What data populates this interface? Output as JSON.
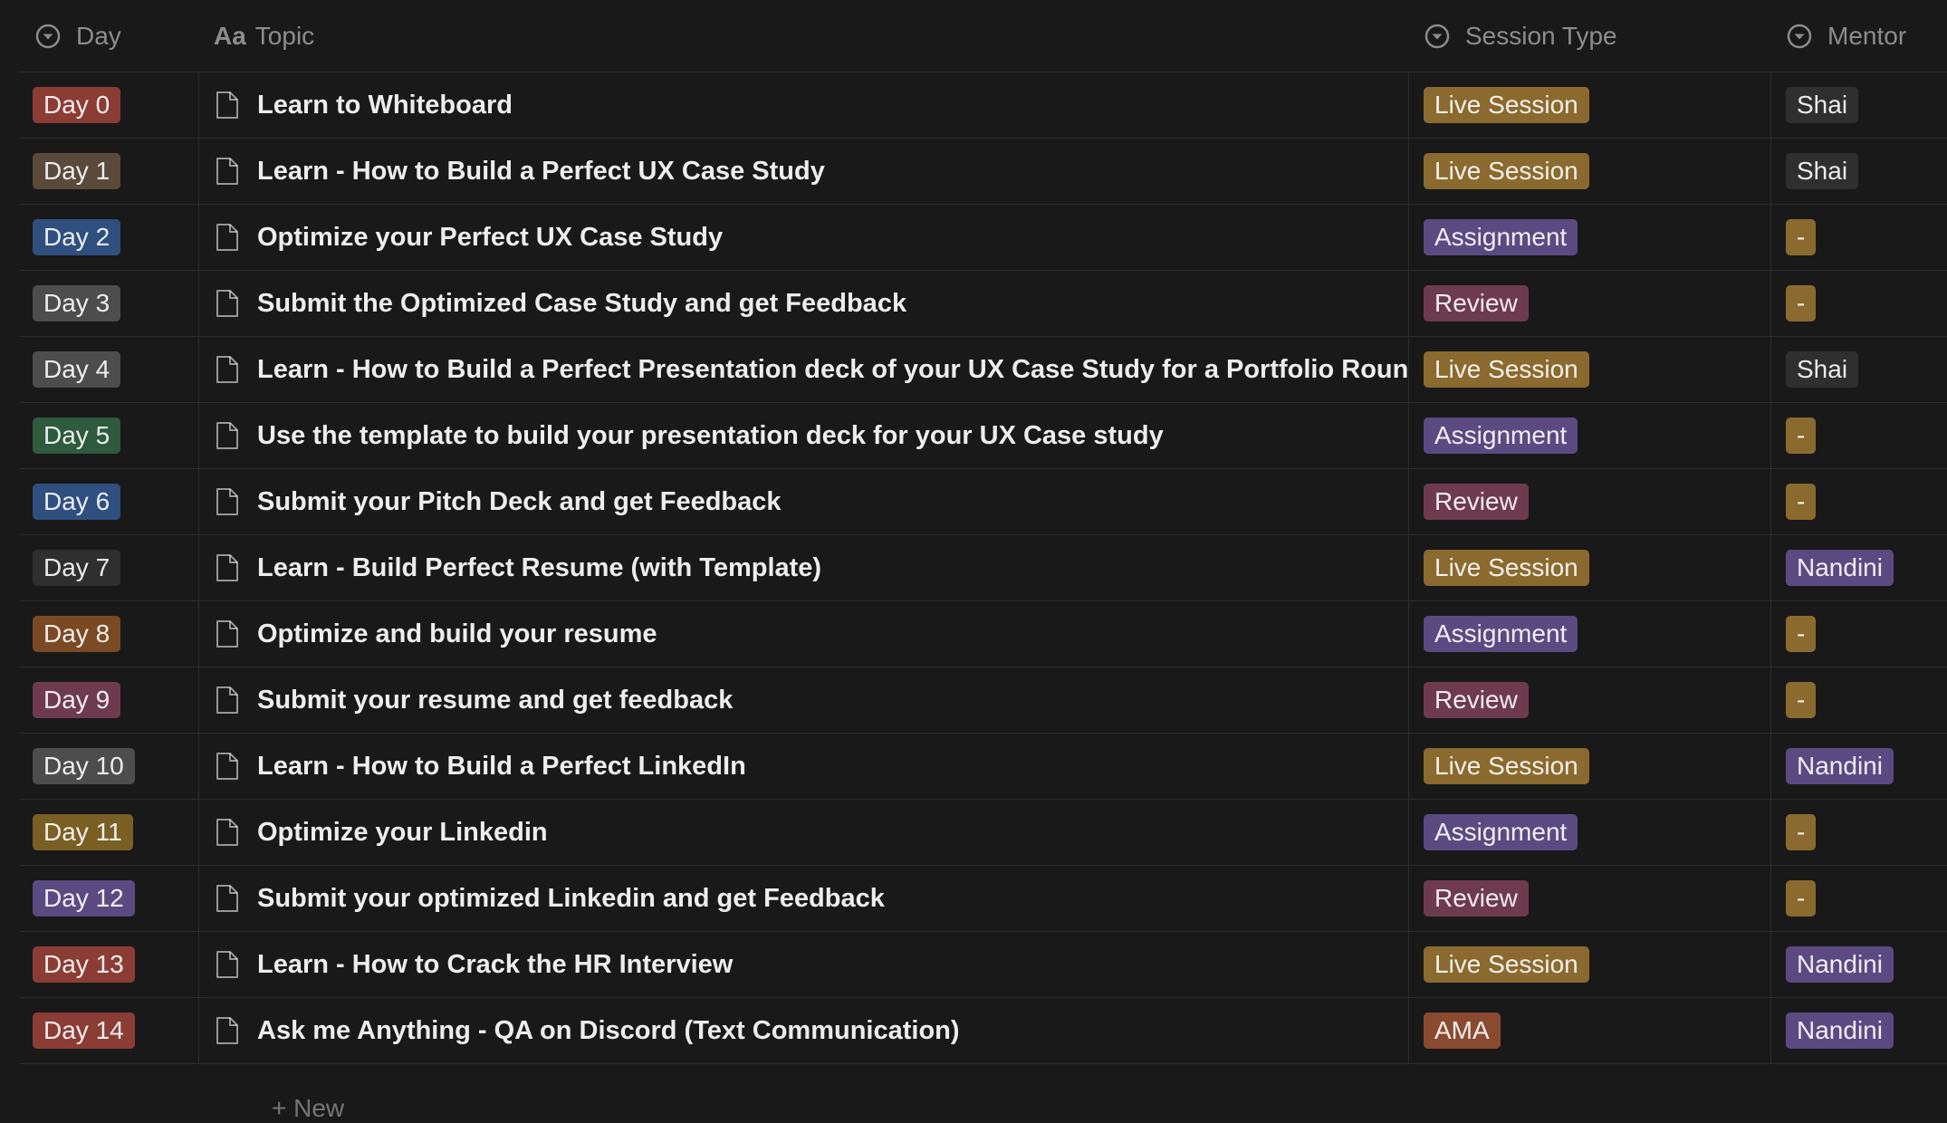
{
  "columns": {
    "day": "Day",
    "topic": "Topic",
    "session_type": "Session Type",
    "mentor": "Mentor",
    "day_icon": "select-icon",
    "topic_icon": "title-icon",
    "session_icon": "select-icon",
    "mentor_icon": "select-icon"
  },
  "rows": [
    {
      "day": "Day 0",
      "day_color": "#8b3d35",
      "topic": "Learn to Whiteboard",
      "type": "Live Session",
      "type_color": "#8a6a2e",
      "mentor": "Shai",
      "mentor_color": "#2f2f2f"
    },
    {
      "day": "Day 1",
      "day_color": "#5a4a3a",
      "topic": "Learn - How to Build a Perfect UX Case Study",
      "type": "Live Session",
      "type_color": "#8a6a2e",
      "mentor": "Shai",
      "mentor_color": "#2f2f2f"
    },
    {
      "day": "Day 2",
      "day_color": "#2f4f7f",
      "topic": "Optimize your Perfect UX Case Study",
      "type": "Assignment",
      "type_color": "#5b4a82",
      "mentor": "-",
      "mentor_color": "#8a6a2e"
    },
    {
      "day": "Day 3",
      "day_color": "#4d4d4d",
      "topic": "Submit the Optimized Case Study and get Feedback",
      "type": "Review",
      "type_color": "#6e3b4e",
      "mentor": "-",
      "mentor_color": "#8a6a2e"
    },
    {
      "day": "Day 4",
      "day_color": "#4d4d4d",
      "topic": "Learn - How to Build a Perfect Presentation deck of your UX Case Study for a Portfolio Round",
      "type": "Live Session",
      "type_color": "#8a6a2e",
      "mentor": "Shai",
      "mentor_color": "#2f2f2f"
    },
    {
      "day": "Day 5",
      "day_color": "#2e5a3e",
      "topic": "Use the template to build your presentation deck for your UX Case study",
      "type": "Assignment",
      "type_color": "#5b4a82",
      "mentor": "-",
      "mentor_color": "#8a6a2e"
    },
    {
      "day": "Day 6",
      "day_color": "#2f4f7f",
      "topic": "Submit your Pitch Deck and get Feedback",
      "type": "Review",
      "type_color": "#6e3b4e",
      "mentor": "-",
      "mentor_color": "#8a6a2e"
    },
    {
      "day": "Day 7",
      "day_color": "#2f2f2f",
      "topic": "Learn - Build Perfect Resume (with Template)",
      "type": "Live Session",
      "type_color": "#8a6a2e",
      "mentor": "Nandini",
      "mentor_color": "#5b4a82"
    },
    {
      "day": "Day 8",
      "day_color": "#7a4a25",
      "topic": "Optimize and build your resume",
      "type": "Assignment",
      "type_color": "#5b4a82",
      "mentor": "-",
      "mentor_color": "#8a6a2e"
    },
    {
      "day": "Day 9",
      "day_color": "#6e3b4e",
      "topic": "Submit your resume and get feedback",
      "type": "Review",
      "type_color": "#6e3b4e",
      "mentor": "-",
      "mentor_color": "#8a6a2e"
    },
    {
      "day": "Day 10",
      "day_color": "#4d4d4d",
      "topic": "Learn - How to Build a Perfect LinkedIn",
      "type": "Live Session",
      "type_color": "#8a6a2e",
      "mentor": "Nandini",
      "mentor_color": "#5b4a82"
    },
    {
      "day": "Day 11",
      "day_color": "#7a5f25",
      "topic": "Optimize your Linkedin",
      "type": "Assignment",
      "type_color": "#5b4a82",
      "mentor": "-",
      "mentor_color": "#8a6a2e"
    },
    {
      "day": "Day 12",
      "day_color": "#5b4a82",
      "topic": "Submit your optimized Linkedin and get Feedback",
      "type": "Review",
      "type_color": "#6e3b4e",
      "mentor": "-",
      "mentor_color": "#8a6a2e"
    },
    {
      "day": "Day 13",
      "day_color": "#8b3d35",
      "topic": "Learn - How to Crack the HR Interview",
      "type": "Live Session",
      "type_color": "#8a6a2e",
      "mentor": "Nandini",
      "mentor_color": "#5b4a82"
    },
    {
      "day": "Day 14",
      "day_color": "#8b3d35",
      "topic": "Ask me Anything - QA on Discord (Text Communication)",
      "type": "AMA",
      "type_color": "#8a4a30",
      "mentor": "Nandini",
      "mentor_color": "#5b4a82"
    }
  ],
  "footer": {
    "new_label": "+ New"
  }
}
